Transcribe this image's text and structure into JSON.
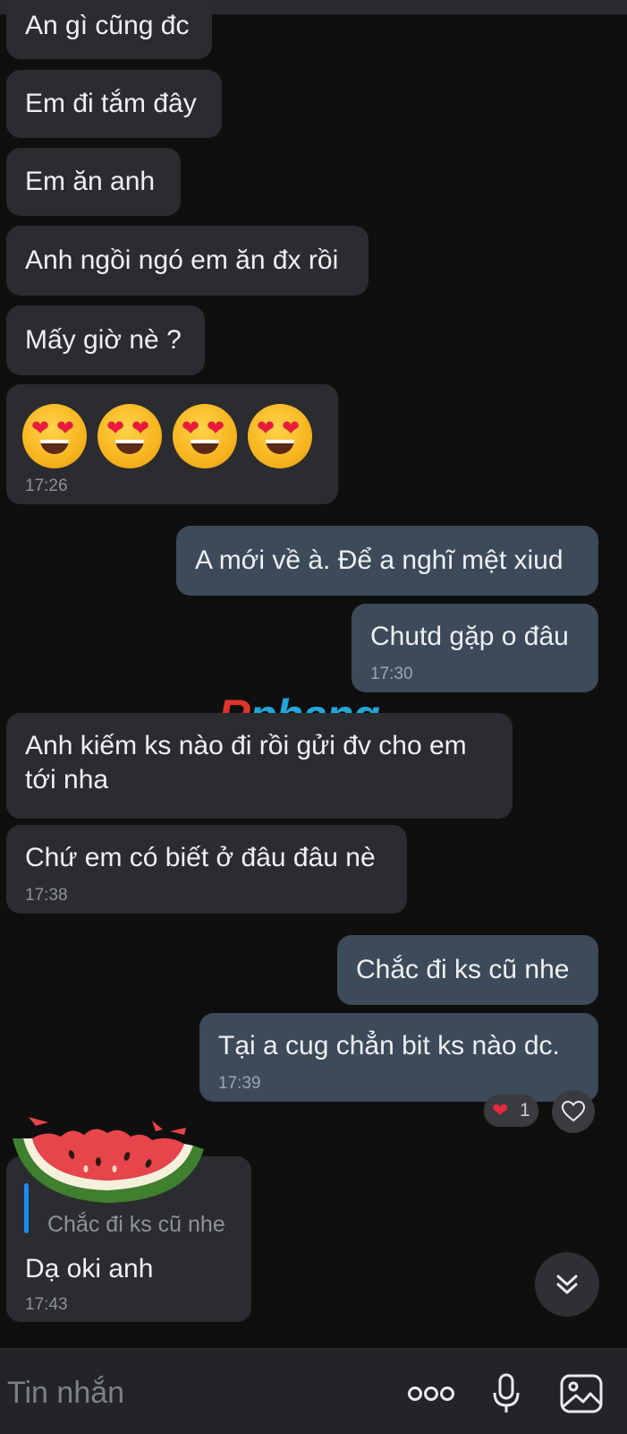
{
  "messages": [
    {
      "text": "An gì cũng đc"
    },
    {
      "text": "Em đi tắm đây"
    },
    {
      "text": "Em ăn anh"
    },
    {
      "text": "Anh ngồi ngó em ăn đx rồi"
    },
    {
      "text": "Mấy giờ nè ?"
    },
    {
      "emoji": "heart-eyes",
      "count": 4,
      "time": "17:26"
    },
    {
      "text": "A mới về à. Để a nghĩ mệt xiud"
    },
    {
      "text": "Chutd gặp o đâu",
      "time": "17:30"
    },
    {
      "line1": "Anh kiếm ks nào đi rồi gửi đv cho em",
      "line2": "tới nha"
    },
    {
      "text": "Chứ em có biết ở đâu đâu nè",
      "time": "17:38"
    },
    {
      "text": "Chắc đi ks cũ nhe"
    },
    {
      "text": "Tại a cug chẳn bit ks nào dc.",
      "time": "17:39"
    },
    {
      "quote": "Chắc đi ks cũ nhe",
      "text": "Dạ oki anh",
      "time": "17:43"
    }
  ],
  "reaction": {
    "count": "1"
  },
  "watermark": {
    "r": "R",
    "rest": "phang"
  },
  "input": {
    "placeholder": "Tin nhắn"
  },
  "colors": {
    "incoming": "#2b2c2f",
    "outgoing": "#3c4a59",
    "background": "#0f0f10",
    "quote_bar": "#1d8cf0"
  }
}
